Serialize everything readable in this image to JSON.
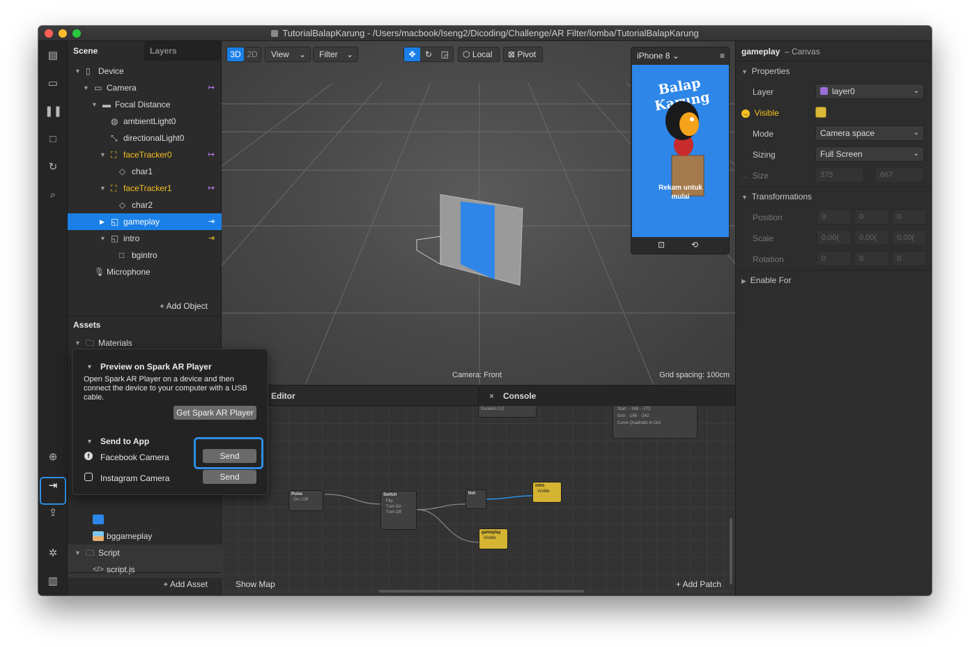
{
  "window": {
    "title": "TutorialBalapKarung - /Users/macbook/Iseng2/Dicoding/Challenge/AR Filter/lomba/TutorialBalapKarung"
  },
  "scene": {
    "tab_scene": "Scene",
    "tab_layers": "Layers",
    "tree": [
      {
        "label": "Device"
      },
      {
        "label": "Camera"
      },
      {
        "label": "Focal Distance"
      },
      {
        "label": "ambientLight0"
      },
      {
        "label": "directionalLight0"
      },
      {
        "label": "faceTracker0"
      },
      {
        "label": "char1"
      },
      {
        "label": "faceTracker1"
      },
      {
        "label": "char2"
      },
      {
        "label": "gameplay"
      },
      {
        "label": "intro"
      },
      {
        "label": "bgintro"
      },
      {
        "label": "Microphone"
      }
    ],
    "add_object": "Add Object"
  },
  "assets": {
    "title": "Assets",
    "items": [
      {
        "label": "Materials"
      },
      {
        "label": "bggameplay"
      },
      {
        "label": "Script"
      },
      {
        "label": "script.js"
      }
    ],
    "add_asset": "Add Asset"
  },
  "viewport": {
    "mode_3d": "3D",
    "mode_2d": "2D",
    "view": "View",
    "filter": "Filter",
    "local": "Local",
    "pivot": "Pivot",
    "camera_label": "Camera: Front",
    "grid_label": "Grid spacing: 100cm"
  },
  "phone": {
    "device": "iPhone 8",
    "headline": "Balap Karung",
    "caption_line1": "Rekam untuk",
    "caption_line2": "mulai"
  },
  "patch_editor": {
    "tab_editor": "Editor",
    "tab_console": "Console",
    "show_map": "Show Map",
    "add_patch": "Add Patch",
    "nodes": {
      "pulse": "Pulse",
      "pulse_port": "On / Off",
      "switch": "Switch",
      "switch_flip": "Flip",
      "switch_on": "Turn On",
      "switch_off": "Turn Off",
      "not": "Not",
      "intro": "intro",
      "intro_port": "Visible",
      "gameplay": "gameplay",
      "gameplay_port": "Visible",
      "duration": "Duration",
      "duration_value": "0,3",
      "start": "Start",
      "start_v1": "-166",
      "start_v2": "-272",
      "end": "End",
      "end_v1": "-166",
      "end_v2": "-242",
      "curve": "Curve",
      "curve_value": "Quadratic In-Out"
    }
  },
  "properties": {
    "object": "gameplay",
    "type": "– Canvas",
    "section_properties": "Properties",
    "layer_label": "Layer",
    "layer_value": "layer0",
    "visible_label": "Visible",
    "mode_label": "Mode",
    "mode_value": "Camera space",
    "sizing_label": "Sizing",
    "sizing_value": "Full Screen",
    "size_label": "Size",
    "size_w": "375",
    "size_h": "667",
    "section_transform": "Transformations",
    "position_label": "Position",
    "scale_label": "Scale",
    "rotation_label": "Rotation",
    "zero": "0",
    "scale_val": "0,00(",
    "enable_for": "Enable For"
  },
  "popup": {
    "preview_title": "Preview on Spark AR Player",
    "preview_desc": "Open Spark AR Player on a device and then connect the device to your computer with a USB cable.",
    "get_player": "Get Spark AR Player",
    "send_title": "Send to App",
    "facebook": "Facebook Camera",
    "instagram": "Instagram Camera",
    "send": "Send"
  },
  "colors": {
    "accent": "#1a80e8",
    "highlight": "#2f8de4",
    "yellow": "#f4c020",
    "phone_bg": "#2d86e8"
  }
}
